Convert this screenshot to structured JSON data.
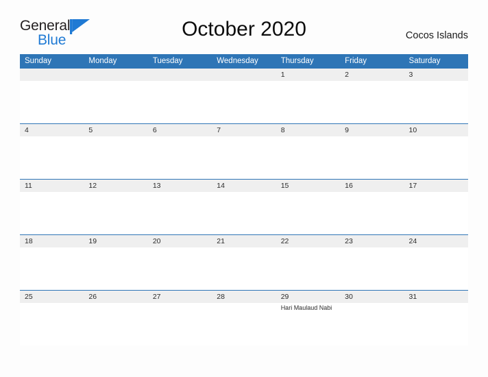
{
  "brand": {
    "name_part1": "General",
    "name_part2": "Blue",
    "flag_icon": "flag-triangle-icon",
    "color_primary": "#1f7ad4",
    "color_text": "#231f20"
  },
  "header": {
    "title": "October 2020",
    "location": "Cocos Islands"
  },
  "calendar": {
    "header_color": "#2e75b6",
    "band_color": "#efefef",
    "weekdays": [
      "Sunday",
      "Monday",
      "Tuesday",
      "Wednesday",
      "Thursday",
      "Friday",
      "Saturday"
    ],
    "weeks": [
      [
        {
          "day": "",
          "event": ""
        },
        {
          "day": "",
          "event": ""
        },
        {
          "day": "",
          "event": ""
        },
        {
          "day": "",
          "event": ""
        },
        {
          "day": "1",
          "event": ""
        },
        {
          "day": "2",
          "event": ""
        },
        {
          "day": "3",
          "event": ""
        }
      ],
      [
        {
          "day": "4",
          "event": ""
        },
        {
          "day": "5",
          "event": ""
        },
        {
          "day": "6",
          "event": ""
        },
        {
          "day": "7",
          "event": ""
        },
        {
          "day": "8",
          "event": ""
        },
        {
          "day": "9",
          "event": ""
        },
        {
          "day": "10",
          "event": ""
        }
      ],
      [
        {
          "day": "11",
          "event": ""
        },
        {
          "day": "12",
          "event": ""
        },
        {
          "day": "13",
          "event": ""
        },
        {
          "day": "14",
          "event": ""
        },
        {
          "day": "15",
          "event": ""
        },
        {
          "day": "16",
          "event": ""
        },
        {
          "day": "17",
          "event": ""
        }
      ],
      [
        {
          "day": "18",
          "event": ""
        },
        {
          "day": "19",
          "event": ""
        },
        {
          "day": "20",
          "event": ""
        },
        {
          "day": "21",
          "event": ""
        },
        {
          "day": "22",
          "event": ""
        },
        {
          "day": "23",
          "event": ""
        },
        {
          "day": "24",
          "event": ""
        }
      ],
      [
        {
          "day": "25",
          "event": ""
        },
        {
          "day": "26",
          "event": ""
        },
        {
          "day": "27",
          "event": ""
        },
        {
          "day": "28",
          "event": ""
        },
        {
          "day": "29",
          "event": "Hari Maulaud Nabi"
        },
        {
          "day": "30",
          "event": ""
        },
        {
          "day": "31",
          "event": ""
        }
      ]
    ]
  }
}
